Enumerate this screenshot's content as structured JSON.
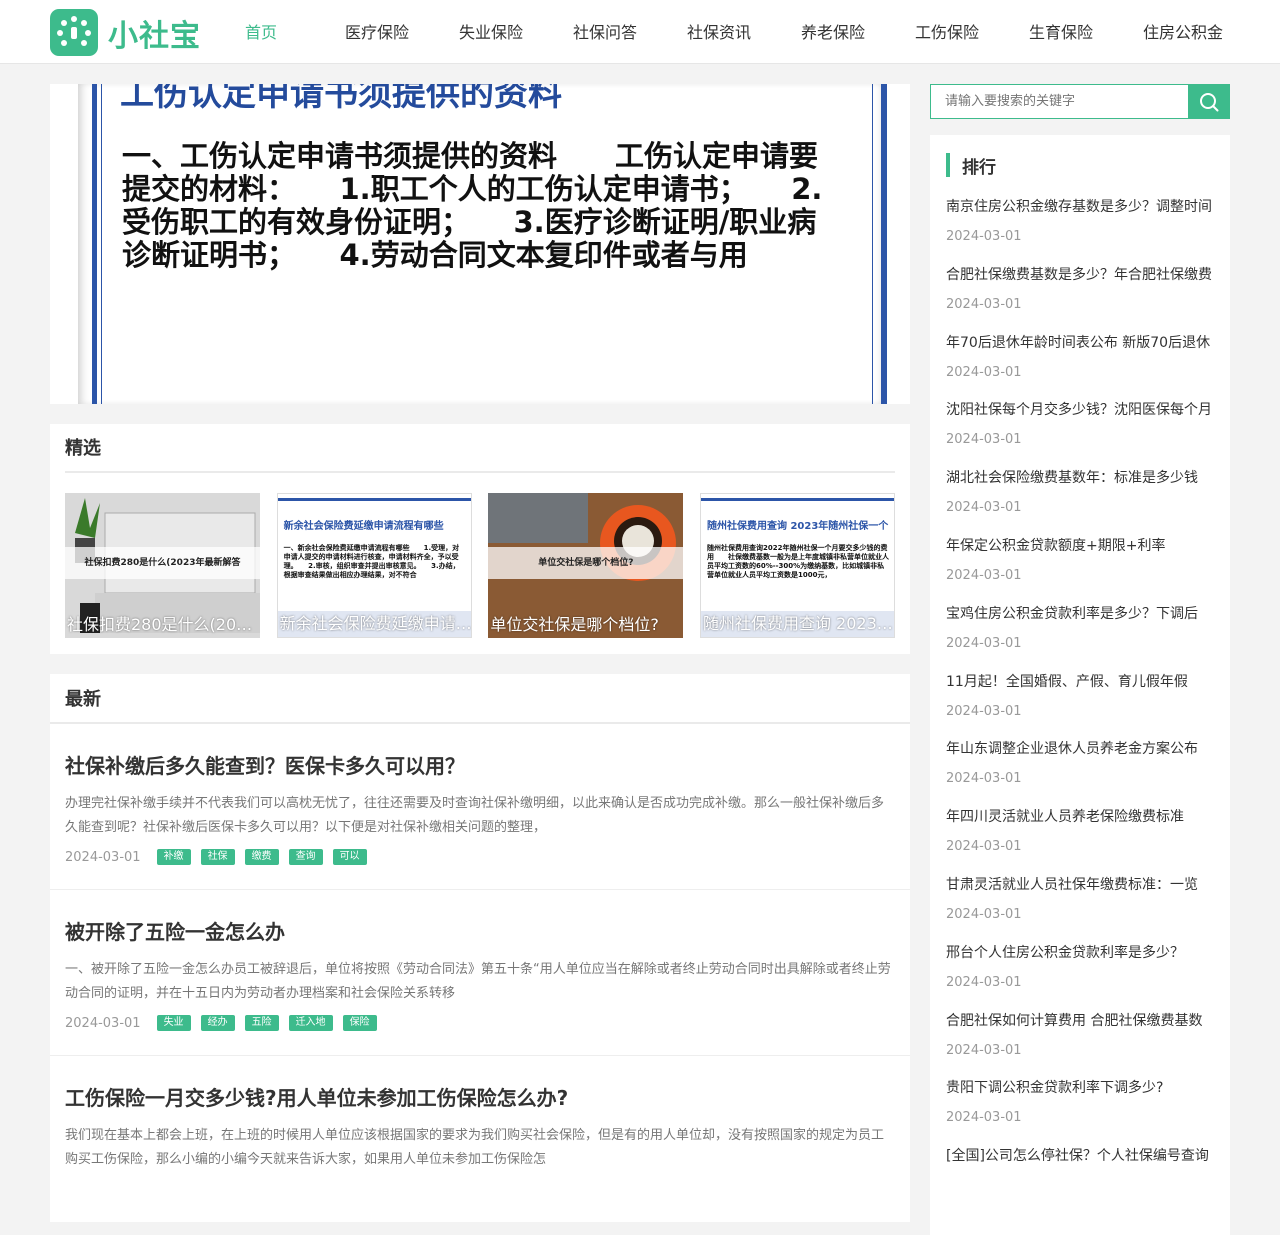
{
  "brand": {
    "name": "小社宝",
    "accent": "#3dbb8c"
  },
  "nav": [
    {
      "label": "首页",
      "active": true
    },
    {
      "label": "医疗保险"
    },
    {
      "label": "失业保险"
    },
    {
      "label": "社保问答"
    },
    {
      "label": "社保资讯"
    },
    {
      "label": "养老保险"
    },
    {
      "label": "工伤保险"
    },
    {
      "label": "生育保险"
    },
    {
      "label": "住房公积金"
    }
  ],
  "banner": {
    "title": "工伤认定申请书须提供的资料",
    "body": "一、工伤认定申请书须提供的资料　　工伤认定申请要提交的材料：　　1.职工个人的工伤认定申请书；　　2.受伤职工的有效身份证明；　　3.医疗诊断证明/职业病诊断证明书；　　4.劳动合同文本复印件或者与用"
  },
  "featured": {
    "heading": "精选",
    "items": [
      {
        "caption": "社保扣费280是什么(2023年最新解答)",
        "overlay": "社保扣费280是什么(2023年最新解答"
      },
      {
        "caption": "新余社会保险费延缴申请流程有哪些",
        "doc_title": "新余社会保险费延缴申请流程有哪些",
        "doc_body": "一、新余社会保险费延缴申请流程有哪些　　1.受理，对申请人提交的申请材料进行核查，申请材料齐全，予以受理。　　2.审核，组织审查并提出审核意见。　　3.办结，根据审查结果做出相应办理结果，对不符合"
      },
      {
        "caption": "单位交社保是哪个档位?",
        "overlay": "单位交社保是哪个档位?"
      },
      {
        "caption": "随州社保费用查询 2023年随州社保一个",
        "doc_title": "随州社保费用查询 2023年随州社保一个",
        "doc_body": "随州社保费用查询2022年随州社保一个月要交多少钱的费用　　社保缴费基数一般为是上年度城镇非私营单位就业人员平均工资数的60%--300%为缴纳基数，比如城镇非私营单位就业人员平均工资数是1000元，"
      }
    ]
  },
  "latest": {
    "heading": "最新",
    "articles": [
      {
        "title": "社保补缴后多久能查到？医保卡多久可以用？",
        "summary": "办理完社保补缴手续并不代表我们可以高枕无忧了，往往还需要及时查询社保补缴明细，以此来确认是否成功完成补缴。那么一般社保补缴后多久能查到呢？社保补缴后医保卡多久可以用？以下便是对社保补缴相关问题的整理，",
        "date": "2024-03-01",
        "tags": [
          "补缴",
          "社保",
          "缴费",
          "查询",
          "可以"
        ]
      },
      {
        "title": "被开除了五险一金怎么办",
        "summary": "一、被开除了五险一金怎么办员工被辞退后，单位将按照《劳动合同法》第五十条“用人单位应当在解除或者终止劳动合同时出具解除或者终止劳动合同的证明，并在十五日内为劳动者办理档案和社会保险关系转移",
        "date": "2024-03-01",
        "tags": [
          "失业",
          "经办",
          "五险",
          "迁入地",
          "保险"
        ]
      },
      {
        "title": "工伤保险一月交多少钱?用人单位未参加工伤保险怎么办?",
        "summary": "我们现在基本上都会上班，在上班的时候用人单位应该根据国家的要求为我们购买社会保险，但是有的用人单位却，没有按照国家的规定为员工购买工伤保险，那么小编的小编今天就来告诉大家，如果用人单位未参加工伤保险怎",
        "date": "2024-03-01",
        "tags": []
      }
    ]
  },
  "search": {
    "placeholder": "请输入要搜索的关键字"
  },
  "ranking": {
    "heading": "排行",
    "items": [
      {
        "title": "南京住房公积金缴存基数是多少？调整时间",
        "date": "2024-03-01"
      },
      {
        "title": "合肥社保缴费基数是多少？年合肥社保缴费",
        "date": "2024-03-01"
      },
      {
        "title": "年70后退休年龄时间表公布 新版70后退休",
        "date": "2024-03-01"
      },
      {
        "title": "沈阳社保每个月交多少钱？沈阳医保每个月",
        "date": "2024-03-01"
      },
      {
        "title": "湖北社会保险缴费基数年：标准是多少钱",
        "date": "2024-03-01"
      },
      {
        "title": "年保定公积金贷款额度+期限+利率",
        "date": "2024-03-01"
      },
      {
        "title": "宝鸡住房公积金贷款利率是多少？下调后",
        "date": "2024-03-01"
      },
      {
        "title": "11月起！全国婚假、产假、育儿假年假",
        "date": "2024-03-01"
      },
      {
        "title": "年山东调整企业退休人员养老金方案公布",
        "date": "2024-03-01"
      },
      {
        "title": "年四川灵活就业人员养老保险缴费标准",
        "date": "2024-03-01"
      },
      {
        "title": "甘肃灵活就业人员社保年缴费标准：一览",
        "date": "2024-03-01"
      },
      {
        "title": "邢台个人住房公积金贷款利率是多少？",
        "date": "2024-03-01"
      },
      {
        "title": "合肥社保如何计算费用 合肥社保缴费基数",
        "date": "2024-03-01"
      },
      {
        "title": "贵阳下调公积金贷款利率下调多少?",
        "date": "2024-03-01"
      },
      {
        "title": "[全国]公司怎么停社保？个人社保编号查询",
        "date": ""
      }
    ]
  }
}
